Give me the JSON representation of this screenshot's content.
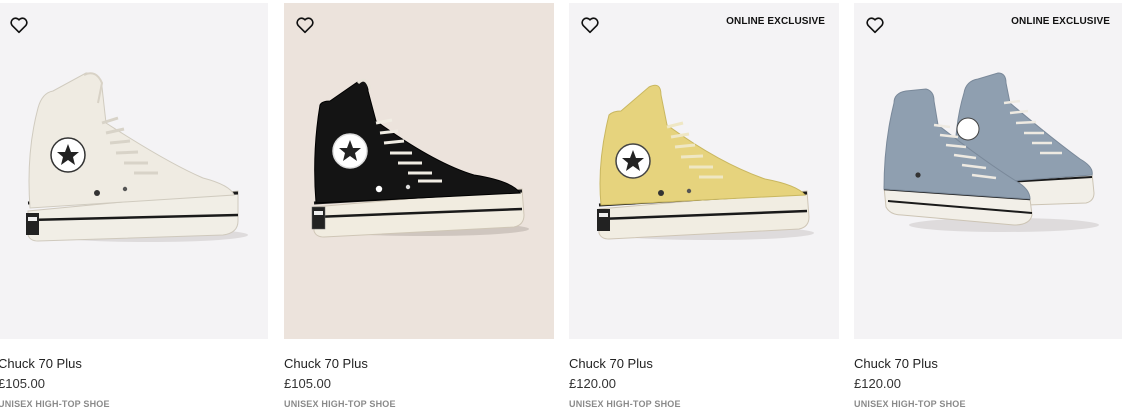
{
  "products": [
    {
      "name": "Chuck 70 Plus",
      "price": "£105.00",
      "subtitle": "UNISEX HIGH-TOP SHOE",
      "badge": "",
      "bg": "#f4f3f5",
      "colorway": "white",
      "upper": "#efebe2",
      "icons": {
        "favorite": "heart-outline-icon"
      }
    },
    {
      "name": "Chuck 70 Plus",
      "price": "£105.00",
      "subtitle": "UNISEX HIGH-TOP SHOE",
      "badge": "",
      "bg": "#ece3dc",
      "colorway": "black",
      "upper": "#141414",
      "icons": {
        "favorite": "heart-outline-icon"
      }
    },
    {
      "name": "Chuck 70 Plus",
      "price": "£120.00",
      "subtitle": "UNISEX HIGH-TOP SHOE",
      "badge": "ONLINE EXCLUSIVE",
      "bg": "#f4f3f5",
      "colorway": "yellow",
      "upper": "#e6d37d",
      "icons": {
        "favorite": "heart-outline-icon"
      }
    },
    {
      "name": "Chuck 70 Plus",
      "price": "£120.00",
      "subtitle": "UNISEX HIGH-TOP SHOE",
      "badge": "ONLINE EXCLUSIVE",
      "bg": "#f4f3f5",
      "colorway": "blue-grey pair",
      "upper": "#8f9fb0",
      "icons": {
        "favorite": "heart-outline-icon"
      }
    }
  ]
}
